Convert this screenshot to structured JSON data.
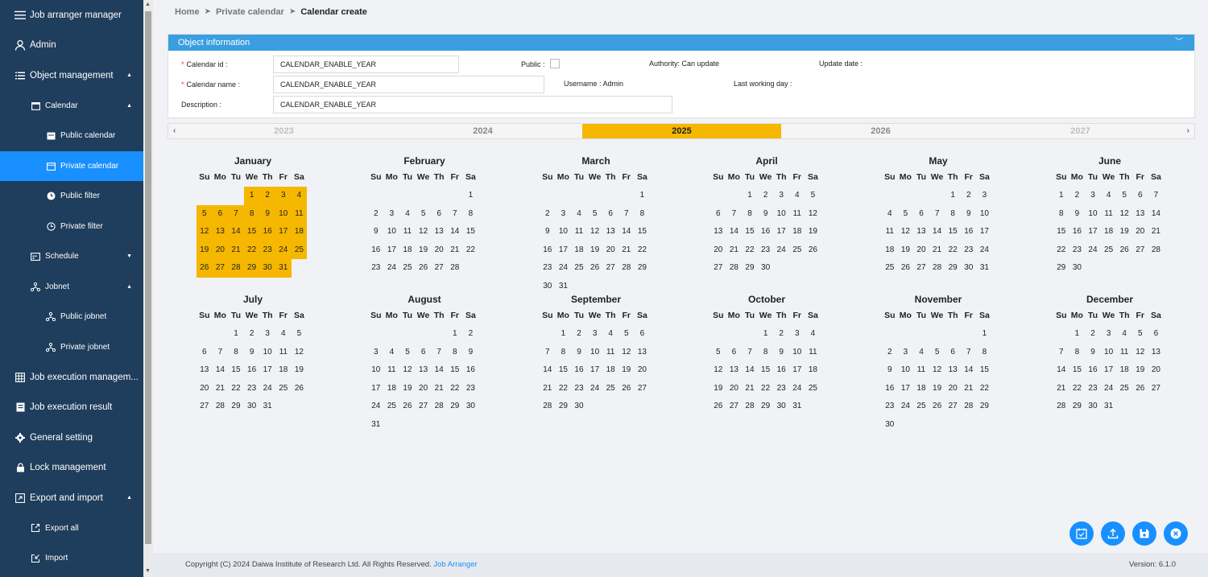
{
  "sidebar": {
    "items": [
      {
        "label": "Job arranger manager",
        "icon": "menu-icon",
        "level": 0,
        "chevron": ""
      },
      {
        "label": "Admin",
        "icon": "user-icon",
        "level": 0,
        "chevron": ""
      },
      {
        "label": "Object management",
        "icon": "list-icon",
        "level": 0,
        "chevron": "up"
      },
      {
        "label": "Calendar",
        "icon": "calendar-icon",
        "level": 1,
        "chevron": "up"
      },
      {
        "label": "Public calendar",
        "icon": "calendar-filled-icon",
        "level": 2,
        "chevron": ""
      },
      {
        "label": "Private calendar",
        "icon": "calendar-outline-icon",
        "level": 2,
        "chevron": "",
        "active": true
      },
      {
        "label": "Public filter",
        "icon": "clock-filled-icon",
        "level": 2,
        "chevron": ""
      },
      {
        "label": "Private filter",
        "icon": "clock-outline-icon",
        "level": 2,
        "chevron": ""
      },
      {
        "label": "Schedule",
        "icon": "schedule-icon",
        "level": 1,
        "chevron": "down"
      },
      {
        "label": "Jobnet",
        "icon": "jobnet-icon",
        "level": 1,
        "chevron": "up"
      },
      {
        "label": "Public jobnet",
        "icon": "jobnet-icon",
        "level": 2,
        "chevron": ""
      },
      {
        "label": "Private jobnet",
        "icon": "jobnet-icon",
        "level": 2,
        "chevron": ""
      },
      {
        "label": "Job execution managem...",
        "icon": "grid-icon",
        "level": 0,
        "chevron": ""
      },
      {
        "label": "Job execution result",
        "icon": "result-icon",
        "level": 0,
        "chevron": ""
      },
      {
        "label": "General setting",
        "icon": "gear-icon",
        "level": 0,
        "chevron": ""
      },
      {
        "label": "Lock management",
        "icon": "lock-icon",
        "level": 0,
        "chevron": ""
      },
      {
        "label": "Export and import",
        "icon": "export-import-icon",
        "level": 0,
        "chevron": "up"
      },
      {
        "label": "Export all",
        "icon": "export-icon",
        "level": 1,
        "chevron": ""
      },
      {
        "label": "Import",
        "icon": "import-icon",
        "level": 1,
        "chevron": ""
      }
    ]
  },
  "breadcrumb": {
    "home": "Home",
    "parent": "Private calendar",
    "current": "Calendar create"
  },
  "panel": {
    "title": "Object information",
    "calendar_id_label": "Calendar id :",
    "calendar_id_value": "CALENDAR_ENABLE_YEAR",
    "calendar_name_label": "Calendar name :",
    "calendar_name_value": "CALENDAR_ENABLE_YEAR",
    "description_label": "Description :",
    "description_value": "CALENDAR_ENABLE_YEAR",
    "public_label": "Public :",
    "authority": "Authority: Can update",
    "update_date_label": "Update date :",
    "username": "Username : Admin",
    "last_working_day_label": "Last working day :"
  },
  "years": {
    "items": [
      "2023",
      "2024",
      "2025",
      "2026",
      "2027"
    ],
    "selected": "2025"
  },
  "calendar": {
    "year": 2025,
    "dow": [
      "Su",
      "Mo",
      "Tu",
      "We",
      "Th",
      "Fr",
      "Sa"
    ],
    "months": [
      {
        "name": "January",
        "start": 3,
        "days": 31,
        "highlighted": true
      },
      {
        "name": "February",
        "start": 6,
        "days": 28
      },
      {
        "name": "March",
        "start": 6,
        "days": 31
      },
      {
        "name": "April",
        "start": 2,
        "days": 30
      },
      {
        "name": "May",
        "start": 4,
        "days": 31
      },
      {
        "name": "June",
        "start": 0,
        "days": 30
      },
      {
        "name": "July",
        "start": 2,
        "days": 31
      },
      {
        "name": "August",
        "start": 5,
        "days": 31
      },
      {
        "name": "September",
        "start": 1,
        "days": 30
      },
      {
        "name": "October",
        "start": 3,
        "days": 31
      },
      {
        "name": "November",
        "start": 6,
        "days": 30
      },
      {
        "name": "December",
        "start": 1,
        "days": 31
      }
    ]
  },
  "actions": [
    {
      "name": "calendar-check-button",
      "icon": "calendar-check-icon"
    },
    {
      "name": "upload-button",
      "icon": "upload-icon"
    },
    {
      "name": "save-button",
      "icon": "save-icon"
    },
    {
      "name": "close-button",
      "icon": "close-icon"
    }
  ],
  "footer": {
    "copyright": "Copyright (C) 2024 Daiwa Institute of Research Ltd. All Rights Reserved.",
    "link": "Job Arranger",
    "version": "Version: 6.1.0"
  },
  "colors": {
    "sidebar": "#1f3d5c",
    "accent": "#1890ff",
    "highlight": "#f5b700",
    "header": "#3a9ee0"
  }
}
